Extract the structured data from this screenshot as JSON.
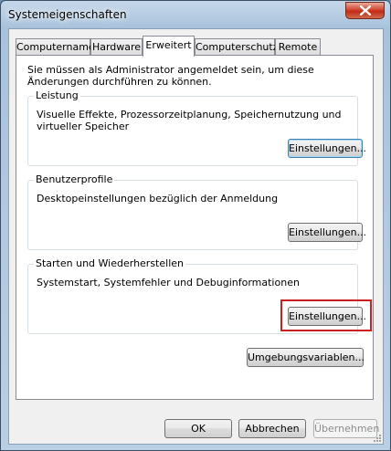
{
  "window": {
    "title": "Systemeigenschaften",
    "close_icon": "close-icon"
  },
  "tabs": [
    {
      "label": "Computername"
    },
    {
      "label": "Hardware"
    },
    {
      "label": "Erweitert",
      "active": true
    },
    {
      "label": "Computerschutz"
    },
    {
      "label": "Remote"
    }
  ],
  "main": {
    "intro": "Sie müssen als Administrator angemeldet sein, um diese Änderungen durchführen zu können.",
    "groups": [
      {
        "label": "Leistung",
        "description": "Visuelle Effekte, Prozessorzeitplanung, Speichernutzung und virtueller Speicher",
        "button": "Einstellungen..."
      },
      {
        "label": "Benutzerprofile",
        "description": "Desktopeinstellungen bezüglich der Anmeldung",
        "button": "Einstellungen..."
      },
      {
        "label": "Starten und Wiederherstellen",
        "description": "Systemstart, Systemfehler und Debuginformationen",
        "button": "Einstellungen...",
        "highlight_color": "#cc1f1f"
      }
    ],
    "env_button": "Umgebungsvariablen..."
  },
  "footer": {
    "ok": "OK",
    "cancel": "Abbrechen",
    "apply": "Übernehmen"
  }
}
